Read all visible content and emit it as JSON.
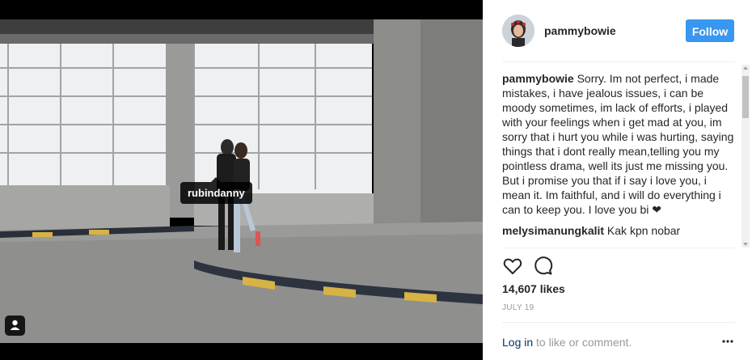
{
  "post": {
    "tagged_user": "rubindanny"
  },
  "header": {
    "username": "pammybowie",
    "follow_label": "Follow"
  },
  "caption": {
    "author": "pammybowie",
    "text": " Sorry. Im not perfect, i made mistakes, i have jealous issues, i can be moody sometimes, im lack of efforts, i played with your feelings when i get mad at you, im sorry that i hurt you while i was hurting, saying things that i dont really mean,telling you my pointless drama, well its just me missing you. But i promise you that if i say i love you, i mean it. Im faithful, and i will do everything i can to keep you. I love you bi ❤"
  },
  "next_comment": {
    "author": "melysimanungkalit",
    "text": " Kak kpn nobar"
  },
  "likes": "14,607 likes",
  "date": "JULY 19",
  "footer": {
    "login_link": "Log in",
    "login_rest": " to like or comment."
  },
  "icons": {
    "like": "heart-icon",
    "comment": "comment-bubble-icon",
    "more": "more-options-icon",
    "user_tag": "user-tag-icon"
  },
  "colors": {
    "follow_button": "#3897f0",
    "link": "#003569"
  }
}
